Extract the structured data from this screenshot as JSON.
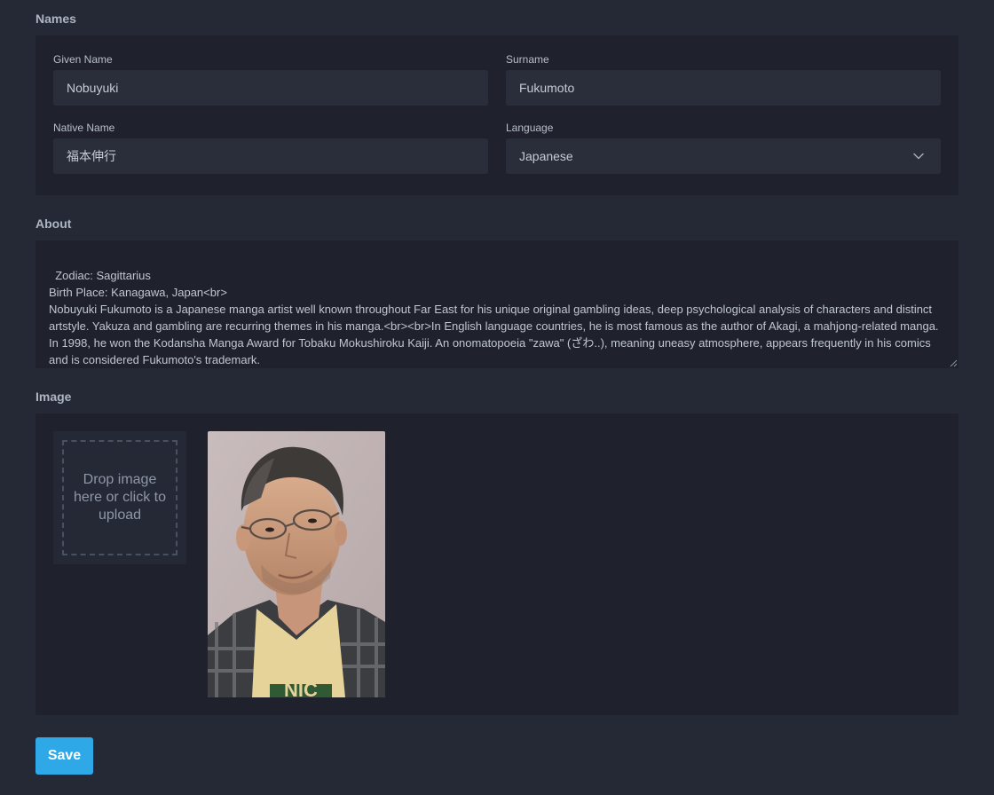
{
  "names": {
    "title": "Names",
    "given_name_label": "Given Name",
    "given_name_value": "Nobuyuki",
    "surname_label": "Surname",
    "surname_value": "Fukumoto",
    "native_name_label": "Native Name",
    "native_name_value": "福本伸行",
    "language_label": "Language",
    "language_value": "Japanese"
  },
  "about": {
    "title": "About",
    "text": "Zodiac: Sagittarius\nBirth Place: Kanagawa, Japan<br>\nNobuyuki Fukumoto is a Japanese manga artist well known throughout Far East for his unique original gambling ideas, deep psychological analysis of characters and distinct artstyle. Yakuza and gambling are recurring themes in his manga.<br><br>In English language countries, he is most famous as the author of Akagi, a mahjong-related manga. In 1998, he won the Kodansha Manga Award for Tobaku Mokushiroku Kaiji. An onomatopoeia \"zawa\" (ざわ..), meaning uneasy atmosphere, appears frequently in his comics and is considered Fukumoto's trademark."
  },
  "image": {
    "title": "Image",
    "dropzone_text": "Drop image here or click to upload",
    "photo_shirt_text": "NIC"
  },
  "actions": {
    "save_label": "Save"
  },
  "icons": {
    "language_select": "chevron-down-icon",
    "textarea_resize": "resize-grip-icon"
  }
}
